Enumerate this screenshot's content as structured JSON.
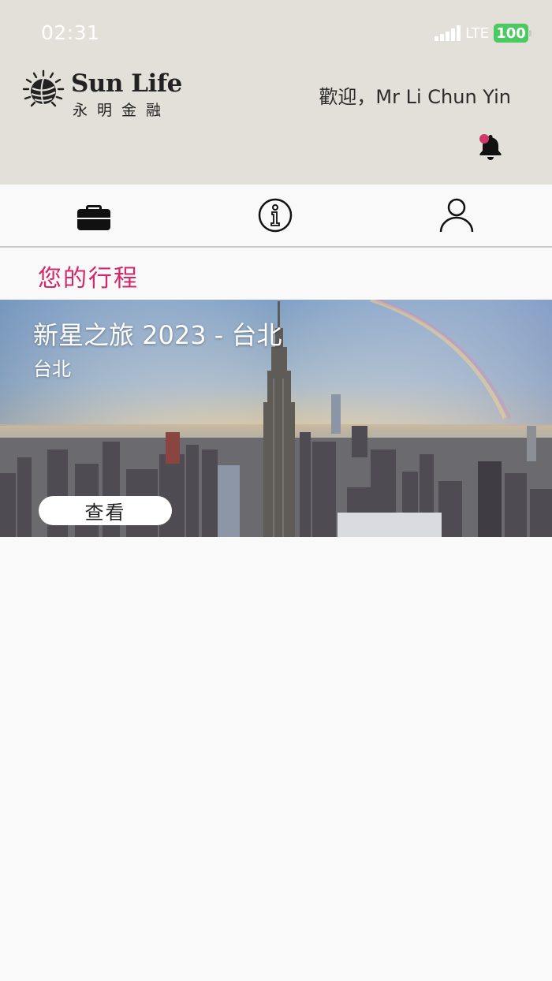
{
  "status_bar": {
    "time": "02:31",
    "network": "LTE",
    "battery": "100"
  },
  "header": {
    "logo_name": "Sun Life",
    "logo_sub": "永明金融",
    "welcome": "歡迎，Mr Li Chun Yin",
    "notification_dot_color": "#d2376b"
  },
  "tabs": [
    {
      "icon": "briefcase-icon"
    },
    {
      "icon": "info-icon"
    },
    {
      "icon": "user-icon"
    }
  ],
  "main": {
    "section_title": "您的行程",
    "accent_color": "#d4266b"
  },
  "trip": {
    "title": "新星之旅 2023 - 台北",
    "location": "台北",
    "view_label": "查看"
  }
}
